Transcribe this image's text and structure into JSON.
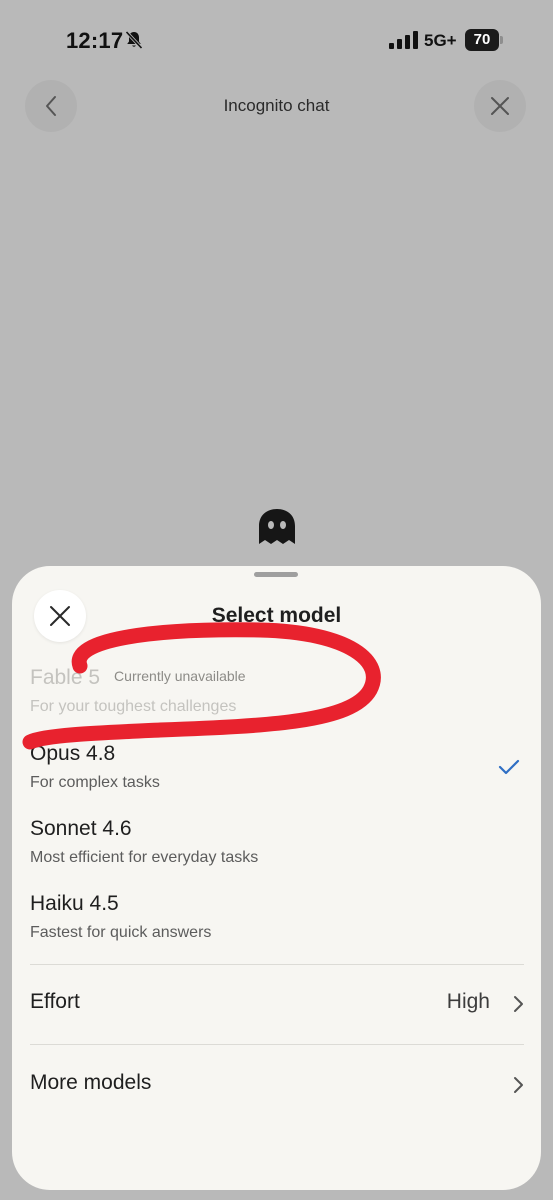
{
  "status_bar": {
    "time": "12:17",
    "network": "5G+",
    "battery": "70",
    "icons": [
      "bell-slash-icon",
      "signal-bars-icon",
      "battery-icon"
    ]
  },
  "header": {
    "title": "Incognito chat",
    "icons": [
      "back-arrow-icon",
      "close-icon"
    ]
  },
  "incognito_icon": "ghost-icon",
  "sheet": {
    "title": "Select model",
    "models": [
      {
        "name": "Fable 5",
        "badge": "Currently unavailable",
        "description": "For your toughest challenges",
        "enabled": false,
        "selected": false
      },
      {
        "name": "Opus 4.8",
        "description": "For complex tasks",
        "enabled": true,
        "selected": true
      },
      {
        "name": "Sonnet 4.6",
        "description": "Most efficient for everyday tasks",
        "enabled": true,
        "selected": false
      },
      {
        "name": "Haiku 4.5",
        "description": "Fastest for quick answers",
        "enabled": true,
        "selected": false
      }
    ],
    "effort": {
      "label": "Effort",
      "value": "High"
    },
    "more_models": {
      "label": "More models"
    }
  },
  "colors": {
    "backdrop": "#b9b9b9",
    "sheet": "#f7f6f2",
    "checkmark": "#2f6fc4",
    "annotation": "#e8222e"
  }
}
